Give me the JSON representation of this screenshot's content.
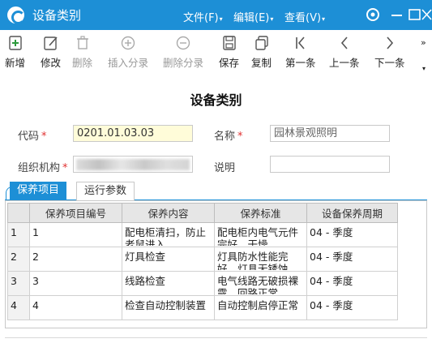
{
  "window": {
    "title": "设备类别",
    "menus": [
      {
        "label": "文件(F)"
      },
      {
        "label": "编辑(E)"
      },
      {
        "label": "查看(V)"
      }
    ]
  },
  "toolbar": {
    "items": [
      {
        "label": "新增",
        "icon": "add-document-icon",
        "enabled": true
      },
      {
        "label": "修改",
        "icon": "edit-icon",
        "enabled": true
      },
      {
        "label": "删除",
        "icon": "trash-icon",
        "enabled": false
      },
      {
        "label": "插入分录",
        "icon": "plus-circle-icon",
        "enabled": false
      },
      {
        "label": "删除分录",
        "icon": "minus-circle-icon",
        "enabled": false
      },
      {
        "label": "保存",
        "icon": "save-icon",
        "enabled": true
      },
      {
        "label": "复制",
        "icon": "copy-icon",
        "enabled": true
      },
      {
        "label": "第一条",
        "icon": "first-record-icon",
        "enabled": true
      },
      {
        "label": "上一条",
        "icon": "previous-record-icon",
        "enabled": true
      },
      {
        "label": "下一条",
        "icon": "next-record-icon",
        "enabled": true
      }
    ],
    "overflow": "»"
  },
  "form": {
    "title": "设备类别",
    "code_label": "代码",
    "code_value": "0201.01.03.03",
    "name_label": "名称",
    "name_value": "园林景观照明",
    "org_label": "组织机构",
    "note_label": "说明",
    "note_value": "",
    "required_mark": "*"
  },
  "tabs": [
    {
      "label": "保养项目",
      "active": true
    },
    {
      "label": "运行参数",
      "active": false
    }
  ],
  "grid": {
    "columns": [
      "",
      "保养项目编号",
      "保养内容",
      "保养标准",
      "设备保养周期"
    ],
    "rows": [
      {
        "n": "1",
        "code": "1",
        "content": "配电柜清扫，防止老鼠进入",
        "standard": "配电柜内电气元件完好，干燥",
        "cycle": "04 - 季度"
      },
      {
        "n": "2",
        "code": "2",
        "content": "灯具检查",
        "standard": "灯具防水性能完好，灯具无锈蚀",
        "cycle": "04 - 季度"
      },
      {
        "n": "3",
        "code": "3",
        "content": "线路检查",
        "standard": "电气线路无破损裸露，回路正常",
        "cycle": "04 - 季度"
      },
      {
        "n": "4",
        "code": "4",
        "content": "检查自动控制装置",
        "standard": "自动控制启停正常",
        "cycle": "04 - 季度"
      }
    ]
  },
  "colors": {
    "accent": "#1d8fd6",
    "required": "#e03030",
    "code_field_bg": "#fffcd9"
  }
}
